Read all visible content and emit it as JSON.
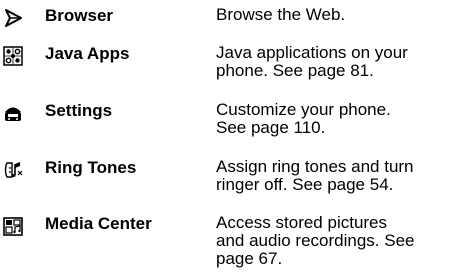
{
  "menu": {
    "items": [
      {
        "icon": "browser-icon",
        "label": "Browser",
        "description_lines": [
          "Browse the Web."
        ]
      },
      {
        "icon": "java-apps-icon",
        "label": "Java Apps",
        "description_lines": [
          "Java applications on your",
          "phone. See page 81."
        ]
      },
      {
        "icon": "settings-icon",
        "label": "Settings",
        "description_lines": [
          "Customize your phone.",
          "See page 110."
        ]
      },
      {
        "icon": "ring-tones-icon",
        "label": "Ring Tones",
        "description_lines": [
          "Assign ring tones and turn",
          "ringer off. See page 54."
        ]
      },
      {
        "icon": "media-center-icon",
        "label": "Media Center",
        "description_lines": [
          "Access stored pictures",
          "and audio recordings. See",
          "page 67."
        ]
      }
    ]
  }
}
